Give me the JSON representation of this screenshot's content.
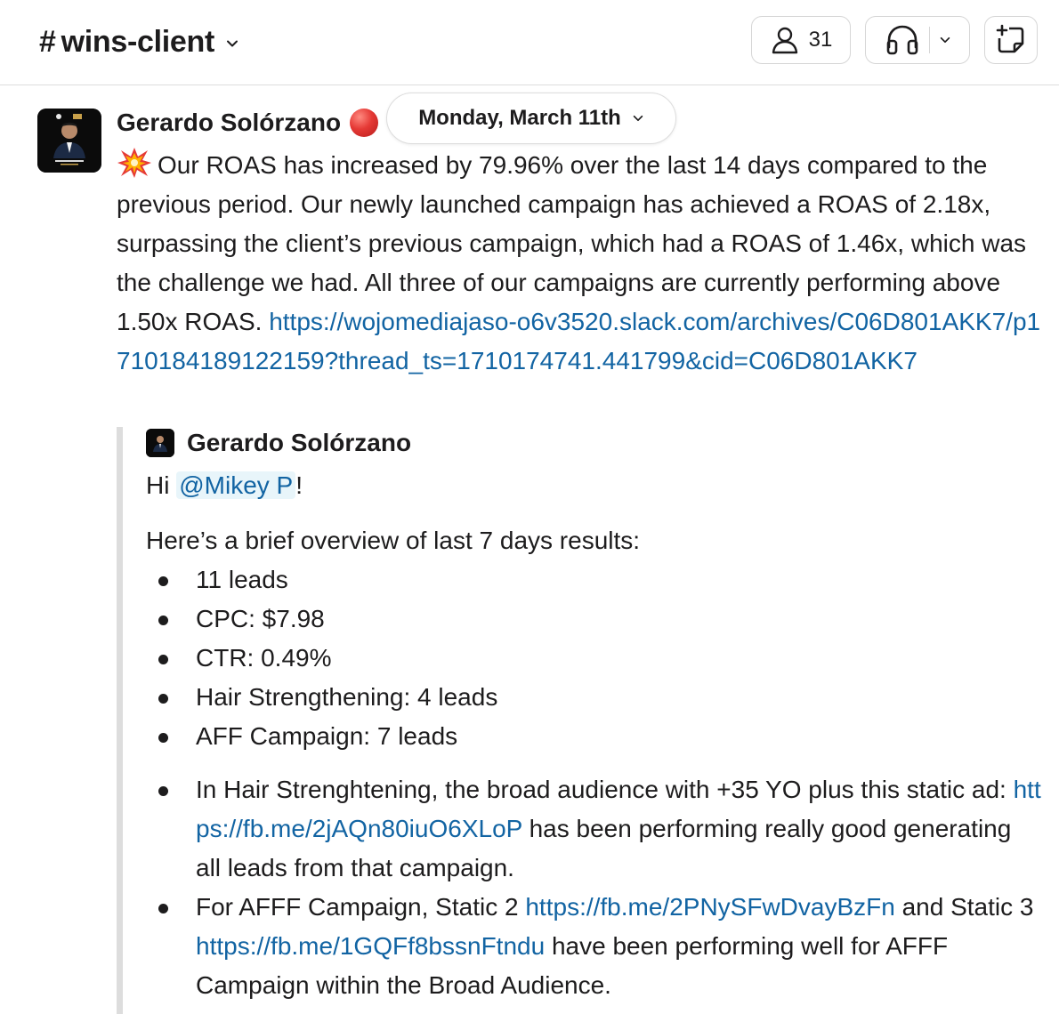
{
  "header": {
    "channel_hash": "#",
    "channel_name": "wins-client",
    "member_count": "31"
  },
  "message": {
    "sender": "Gerardo Solórzano",
    "date_label": "Monday, March 11th",
    "text": "Our ROAS has increased by 79.96% over the last 14 days compared to the previous period. Our newly launched campaign has achieved a ROAS of 2.18x, surpassing the client’s previous campaign, which had a ROAS of 1.46x, which was the challenge we had. All three of our campaigns are currently performing above 1.50x ROAS.",
    "link": "https://wojomediajaso-o6v3520.slack.com/archives/C06D801AKK7/p1710184189122159?thread_ts=1710174741.441799&cid=C06D801AKK7"
  },
  "quote": {
    "author": "Gerardo Solórzano",
    "greeting_prefix": "Hi",
    "mention": "@Mikey P",
    "greeting_suffix": "!",
    "intro": "Here’s a brief overview of last 7 days results:",
    "stats": [
      "11 leads",
      "CPC: $7.98",
      "CTR: 0.49%",
      "Hair Strengthening: 4 leads",
      "AFF Campaign: 7 leads"
    ],
    "notes": {
      "n1_prefix": "In Hair Strenghtening, the broad audience with +35 YO plus this static ad:",
      "n1_link": "https://fb.me/2jAQn80iuO6XLoP",
      "n1_suffix": "has been performing really good generating all leads from that campaign.",
      "n2_prefix": "For AFFF Campaign, Static 2",
      "n2_link1": "https://fb.me/2PNySFwDvayBzFn",
      "n2_mid": "and Static 3",
      "n2_link2": "https://fb.me/1GQFf8bssnFtndu",
      "n2_suffix": "have been performing well for AFFF Campaign within the Broad Audience."
    }
  }
}
